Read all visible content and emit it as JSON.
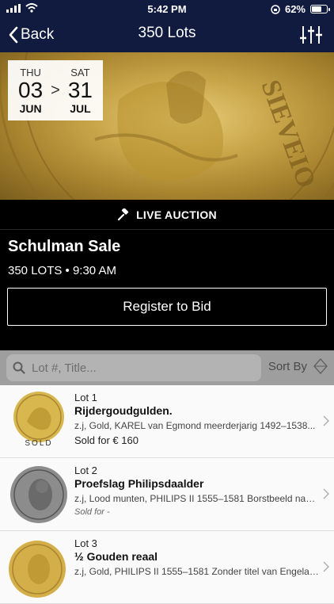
{
  "status": {
    "time": "5:42 PM",
    "battery": "62%",
    "battery_level": 0.62
  },
  "nav": {
    "back_label": "Back",
    "title": "350 Lots"
  },
  "dates": {
    "start_dow": "THU",
    "start_day": "03",
    "start_month": "JUN",
    "separator": ">",
    "end_dow": "SAT",
    "end_day": "31",
    "end_month": "JUL"
  },
  "auction": {
    "live_label": "LIVE AUCTION",
    "sale_name": "Schulman Sale",
    "meta": "350 LOTS • 9:30 AM",
    "register_label": "Register to Bid"
  },
  "search": {
    "placeholder": "Lot #, Title...",
    "sort_label": "Sort By"
  },
  "lots": [
    {
      "number": "Lot 1",
      "title": "Rijdergoudgulden.",
      "desc": "z.j, Gold, KAREL van Egmond meerderjarig 1492–1538...",
      "price": "Sold for € 160",
      "badge": "SOLD"
    },
    {
      "number": "Lot 2",
      "title": "Proefslag Philipsdaalder",
      "desc": "z.j, Lood munten, PHILIPS II 1555–1581 Borstbeeld naar...",
      "price": "Sold for -"
    },
    {
      "number": "Lot 3",
      "title": "½ Gouden reaal",
      "desc": "z.j, Gold, PHILIPS II 1555–1581 Zonder titel van Engelan..."
    }
  ],
  "colors": {
    "nav_bg": "#101b3f",
    "black": "#000000",
    "gold": "#c9a54a"
  }
}
